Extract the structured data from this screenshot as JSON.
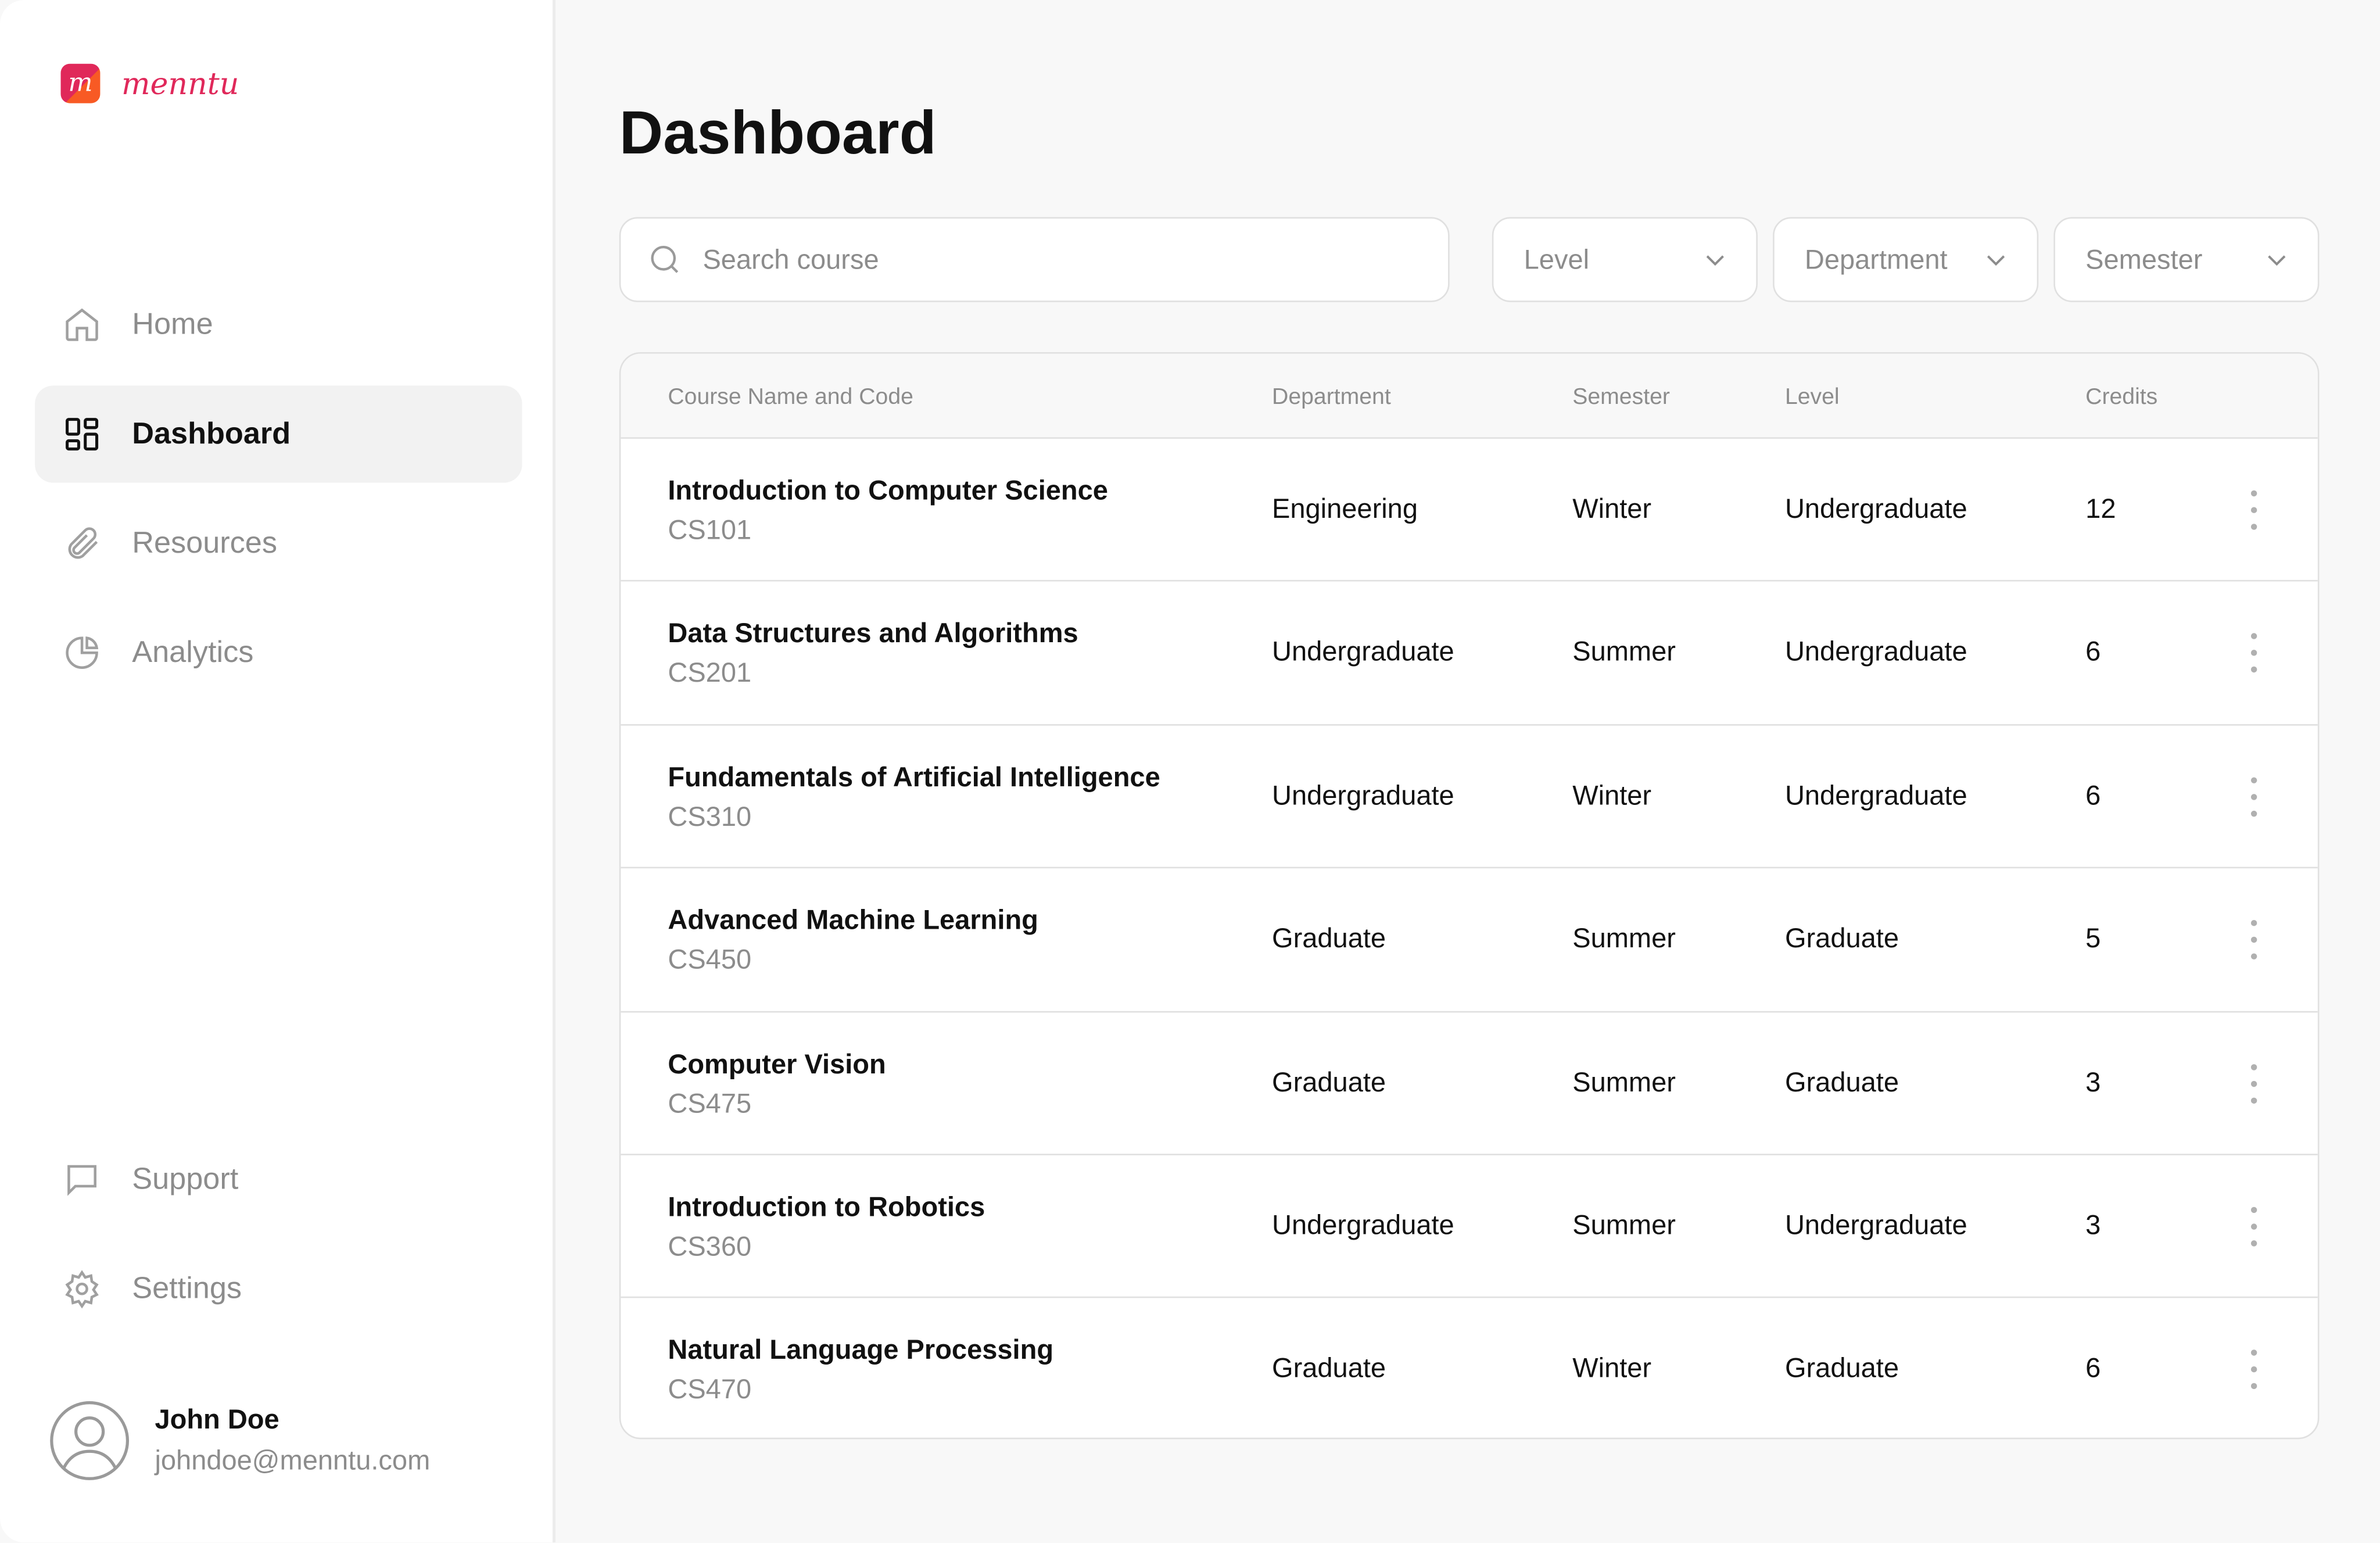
{
  "brand": {
    "name": "menntu",
    "mark": "m",
    "color": "#e0285a"
  },
  "nav": [
    {
      "label": "Home",
      "icon": "home-icon"
    },
    {
      "label": "Dashboard",
      "icon": "dashboard-grid-icon",
      "active": true
    },
    {
      "label": "Resources",
      "icon": "paperclip-icon"
    },
    {
      "label": "Analytics",
      "icon": "pie-chart-icon"
    }
  ],
  "nav_bottom": [
    {
      "label": "Support",
      "icon": "message-icon"
    },
    {
      "label": "Settings",
      "icon": "gear-icon"
    }
  ],
  "user": {
    "name": "John Doe",
    "email": "johndoe@menntu.com"
  },
  "page": {
    "title": "Dashboard"
  },
  "search": {
    "placeholder": "Search course",
    "value": ""
  },
  "filters": [
    {
      "label": "Level"
    },
    {
      "label": "Department"
    },
    {
      "label": "Semester"
    }
  ],
  "table": {
    "columns": [
      "Course Name and Code",
      "Department",
      "Semester",
      "Level",
      "Credits"
    ],
    "rows": [
      {
        "name": "Introduction to Computer Science",
        "code": "CS101",
        "department": "Engineering",
        "semester": "Winter",
        "level": "Undergraduate",
        "credits": "12"
      },
      {
        "name": "Data Structures and Algorithms",
        "code": "CS201",
        "department": "Undergraduate",
        "semester": "Summer",
        "level": "Undergraduate",
        "credits": "6"
      },
      {
        "name": "Fundamentals of Artificial Intelligence",
        "code": "CS310",
        "department": "Undergraduate",
        "semester": "Winter",
        "level": "Undergraduate",
        "credits": "6"
      },
      {
        "name": "Advanced Machine Learning",
        "code": "CS450",
        "department": "Graduate",
        "semester": "Summer",
        "level": "Graduate",
        "credits": "5"
      },
      {
        "name": "Computer Vision",
        "code": "CS475",
        "department": "Graduate",
        "semester": "Summer",
        "level": "Graduate",
        "credits": "3"
      },
      {
        "name": "Introduction to Robotics",
        "code": "CS360",
        "department": "Undergraduate",
        "semester": "Summer",
        "level": "Undergraduate",
        "credits": "3"
      },
      {
        "name": "Natural Language Processing",
        "code": "CS470",
        "department": "Graduate",
        "semester": "Winter",
        "level": "Graduate",
        "credits": "6"
      }
    ]
  }
}
